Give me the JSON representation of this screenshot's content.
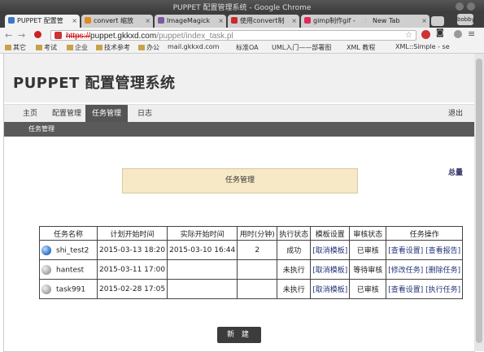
{
  "window": {
    "title": "PUPPET 配置管理系统 - Google Chrome",
    "profile": "bobby"
  },
  "tabs": [
    {
      "label": "PUPPET 配置管",
      "fav": "#3a7ac8",
      "active": true
    },
    {
      "label": "convert 缩放",
      "fav": "#e08a20",
      "active": false
    },
    {
      "label": "ImageMagick",
      "fav": "#7a5aa0",
      "active": false
    },
    {
      "label": "使用convert制",
      "fav": "#cc2a2a",
      "active": false
    },
    {
      "label": "gimp制作gif -",
      "fav": "#e02a5a",
      "active": false
    },
    {
      "label": "New Tab",
      "fav": "#dddddd",
      "active": false
    }
  ],
  "address": {
    "scheme": "https://",
    "domain": "puppet.gkkxd.com",
    "path": "/puppet/index_task.pl"
  },
  "bookmarks": [
    "其它",
    "考试",
    "企业",
    "技术参考",
    "办公",
    "mail.gkkxd.com",
    "标准OA",
    "UML入门——部署图",
    "XML 教程",
    "XML::Simple - se"
  ],
  "page": {
    "title": "PUPPET 配置管理系统",
    "menu": [
      "主页",
      "配置管理",
      "任务管理",
      "日志"
    ],
    "logout": "退出",
    "sub_title": "任务管理",
    "notice": "任务管理",
    "corner_text": "总量",
    "new_button": "新 建"
  },
  "table": {
    "headers": [
      "任务名称",
      "计划开始时间",
      "实际开始时间",
      "用时(分钟)",
      "执行状态",
      "模板设置",
      "审核状态",
      "任务操作"
    ],
    "rows": [
      {
        "icon": "blue",
        "name": "shi_test2",
        "plan": "2015-03-13 18:20",
        "actual": "2015-03-10 16:44",
        "duration": "2",
        "status": "成功",
        "template": "[取消模板]",
        "review": "已审核",
        "op1": "[查看设置]",
        "op2": "[查看报告]"
      },
      {
        "icon": "grey",
        "name": "hantest",
        "plan": "2015-03-11 17:00",
        "actual": "",
        "duration": "",
        "status": "未执行",
        "template": "[取消模板]",
        "review": "等待审核",
        "op1": "[修改任务]",
        "op2": "[删除任务]"
      },
      {
        "icon": "grey",
        "name": "task991",
        "plan": "2015-02-28 17:05",
        "actual": "",
        "duration": "",
        "status": "未执行",
        "template": "[取消模板]",
        "review": "已审核",
        "op1": "[查看设置]",
        "op2": "[执行任务]"
      }
    ]
  }
}
